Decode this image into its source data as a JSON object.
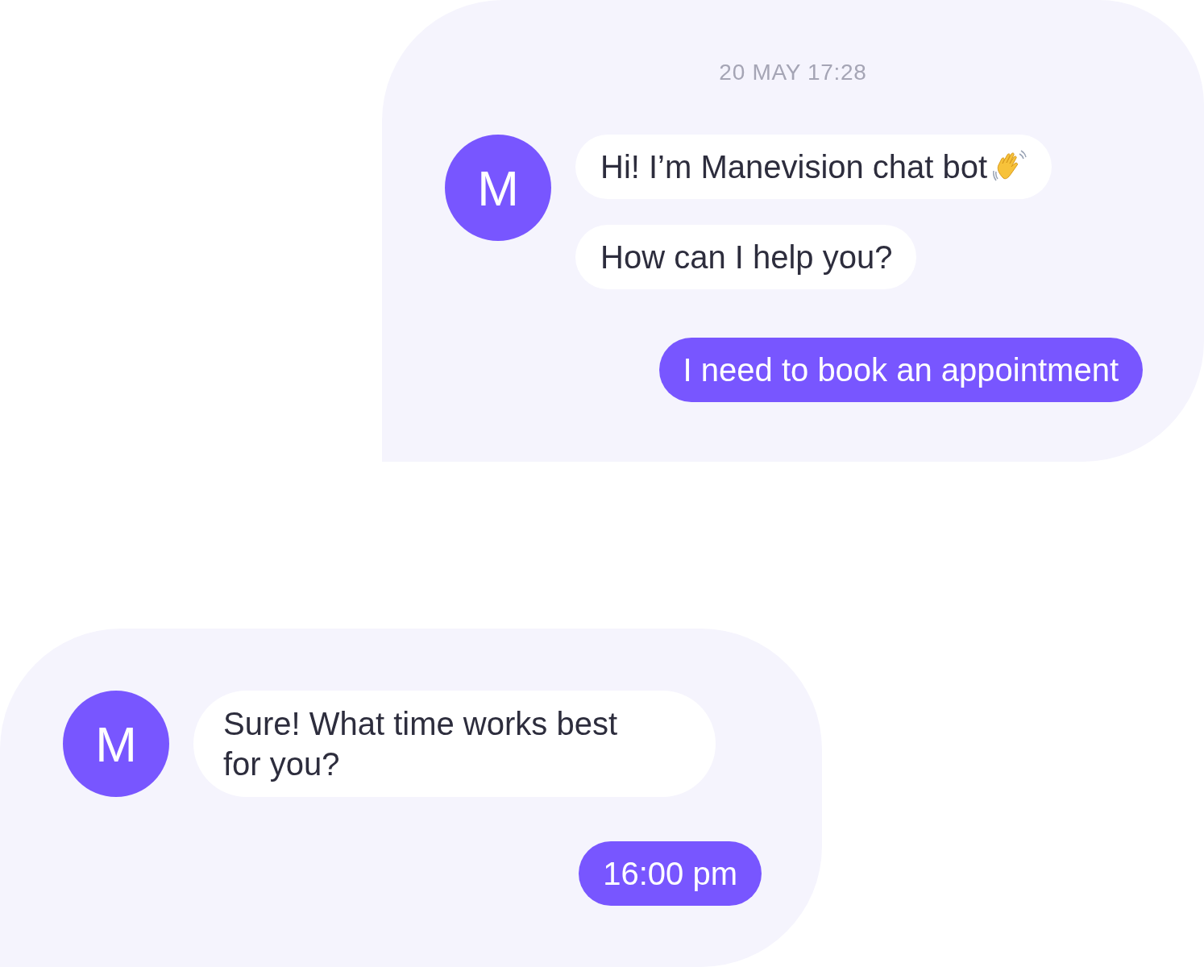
{
  "threads": [
    {
      "timestamp": "20 MAY 17:28",
      "avatar": "M",
      "bot_messages": [
        {
          "text": "Hi! I’m Manevision chat bot",
          "wave": true
        },
        {
          "text": "How can I help you?",
          "wave": false
        }
      ],
      "user_message": "I need to book an appointment"
    },
    {
      "avatar": "M",
      "bot_messages": [
        {
          "text": "Sure! What time works best for you?",
          "wave": false
        }
      ],
      "user_message": "16:00 pm"
    }
  ]
}
